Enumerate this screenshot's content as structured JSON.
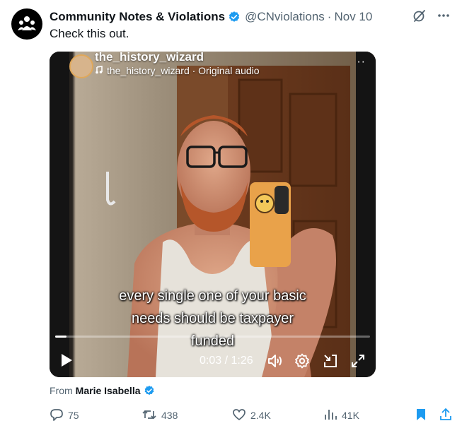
{
  "account": {
    "name": "Community Notes & Violations",
    "handle": "@CNviolations",
    "separator": "·",
    "date": "Nov 10"
  },
  "tweet": {
    "text": "Check this out."
  },
  "video": {
    "ig_username": "the_history_wizard",
    "ig_audio": "the_history_wizard · Original audio",
    "caption_lines": [
      "every single one of your basic",
      "needs should be taxpayer",
      "funded"
    ],
    "time": "0:03 / 1:26",
    "progress_fraction": 0.035
  },
  "attribution": {
    "prefix": "From",
    "name": "Marie Isabella"
  },
  "actions": {
    "replies": "75",
    "reposts": "438",
    "likes": "2.4K",
    "views": "41K"
  },
  "colors": {
    "verified": "#1d9bf0",
    "bookmark": "#1d9bf0",
    "muted_text": "#536471"
  },
  "icons": [
    "grok-icon",
    "more-icon",
    "verified-icon",
    "play-icon",
    "volume-icon",
    "settings-icon",
    "pip-icon",
    "fullscreen-icon",
    "reply-icon",
    "repost-icon",
    "like-icon",
    "views-icon",
    "bookmark-icon",
    "share-icon"
  ]
}
